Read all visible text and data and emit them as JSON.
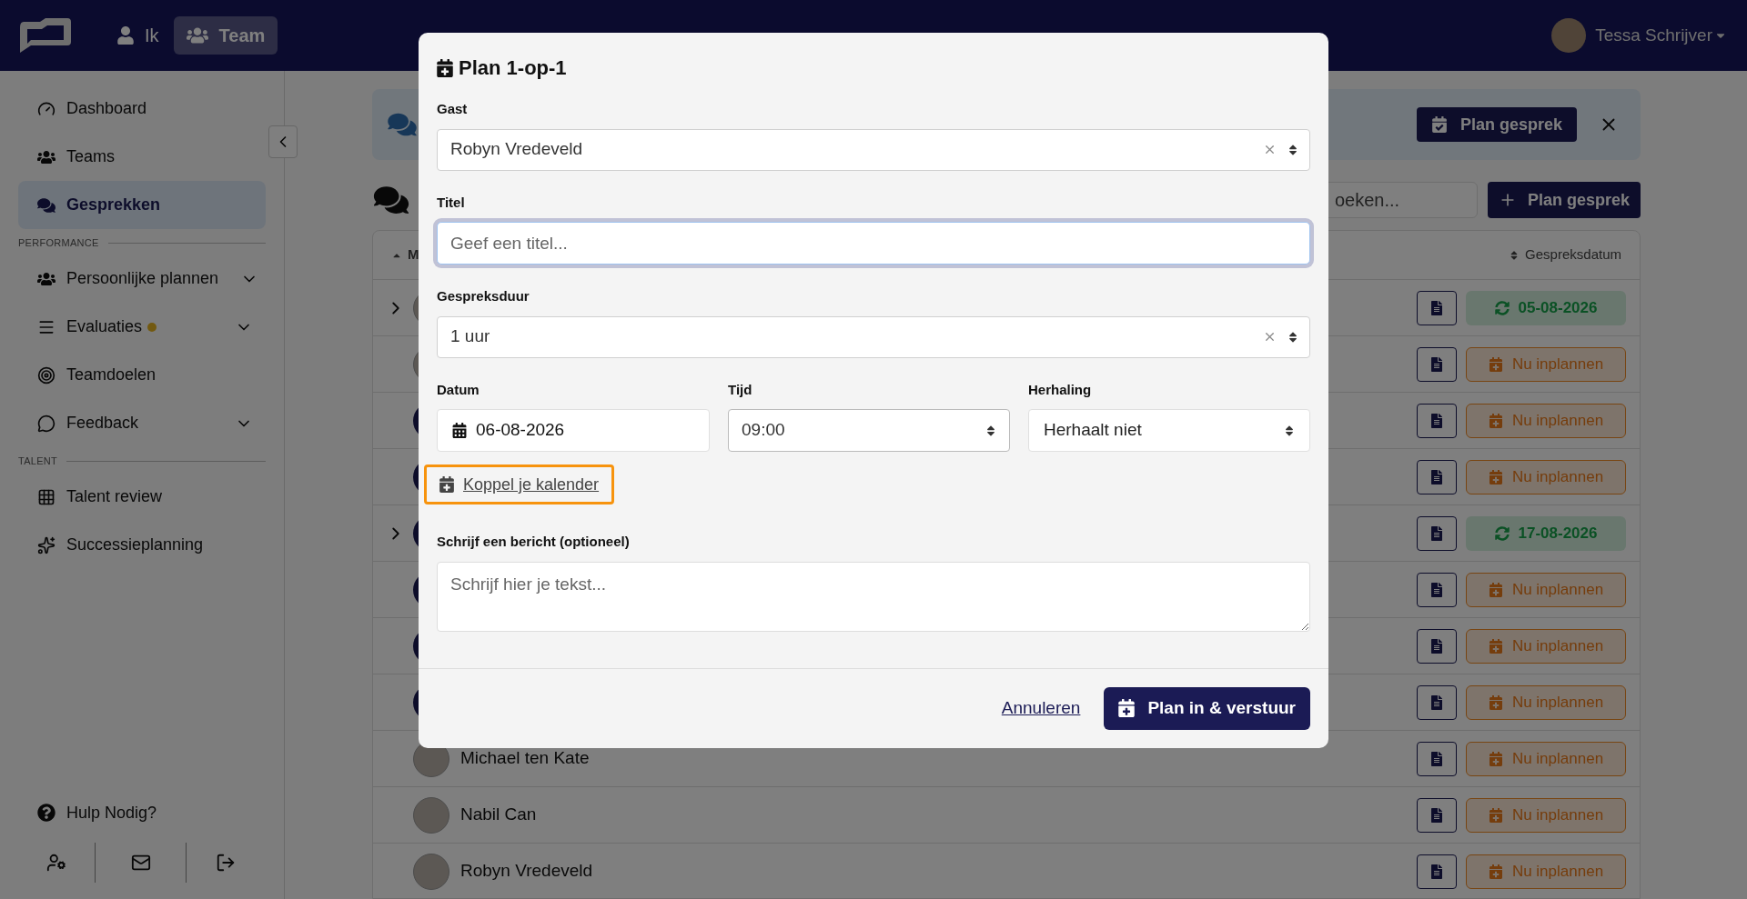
{
  "nav": {
    "tabs": [
      {
        "label": "Ik",
        "selected": false
      },
      {
        "label": "Team",
        "selected": true
      }
    ],
    "user": {
      "name": "Tessa Schrijver"
    }
  },
  "sidebar": {
    "sections": [
      {
        "items": [
          {
            "label": "Dashboard",
            "selected": false,
            "expandable": false,
            "notification": false
          },
          {
            "label": "Teams",
            "selected": false,
            "expandable": false,
            "notification": false
          },
          {
            "label": "Gesprekken",
            "selected": true,
            "expandable": false,
            "notification": false
          }
        ]
      },
      {
        "heading": "PERFORMANCE",
        "items": [
          {
            "label": "Persoonlijke plannen",
            "selected": false,
            "expandable": true,
            "notification": false
          },
          {
            "label": "Evaluaties",
            "selected": false,
            "expandable": true,
            "notification": true
          },
          {
            "label": "Teamdoelen",
            "selected": false,
            "expandable": false,
            "notification": false
          },
          {
            "label": "Feedback",
            "selected": false,
            "expandable": true,
            "notification": false
          }
        ]
      },
      {
        "heading": "TALENT",
        "items": [
          {
            "label": "Talent review",
            "selected": false,
            "expandable": false,
            "notification": false
          },
          {
            "label": "Successieplanning",
            "selected": false,
            "expandable": false,
            "notification": false
          }
        ]
      }
    ],
    "help": "Hulp Nodig?"
  },
  "banner": {
    "button": "Plan gesprek"
  },
  "toolbar": {
    "search_placeholder": "oeken...",
    "button": "Plan gesprek"
  },
  "table": {
    "columns": [
      {
        "label": "M",
        "sorted": true
      },
      {
        "label": "Gespreksdatum",
        "sorted": false
      }
    ],
    "rows": [
      {
        "avatar": {
          "kind": "photo"
        },
        "expandable": true,
        "status": {
          "kind": "scheduled",
          "label": "05-08-2026"
        }
      },
      {
        "avatar": {
          "kind": "photo"
        },
        "expandable": false,
        "status": {
          "kind": "todo",
          "label": "Nu inplannen"
        }
      },
      {
        "avatar": {
          "kind": "initials"
        },
        "expandable": false,
        "status": {
          "kind": "todo",
          "label": "Nu inplannen"
        }
      },
      {
        "avatar": {
          "kind": "initials"
        },
        "expandable": false,
        "status": {
          "kind": "todo",
          "label": "Nu inplannen"
        }
      },
      {
        "avatar": {
          "kind": "initials"
        },
        "expandable": true,
        "status": {
          "kind": "scheduled",
          "label": "17-08-2026"
        }
      },
      {
        "avatar": {
          "kind": "initials"
        },
        "expandable": false,
        "status": {
          "kind": "todo",
          "label": "Nu inplannen"
        }
      },
      {
        "avatar": {
          "kind": "initials"
        },
        "expandable": false,
        "status": {
          "kind": "todo",
          "label": "Nu inplannen"
        }
      },
      {
        "avatar": {
          "kind": "initials"
        },
        "expandable": false,
        "status": {
          "kind": "todo",
          "label": "Nu inplannen"
        }
      },
      {
        "avatar": {
          "kind": "photo"
        },
        "name": "Michael ten Kate",
        "expandable": false,
        "status": {
          "kind": "todo",
          "label": "Nu inplannen"
        }
      },
      {
        "avatar": {
          "kind": "photo"
        },
        "name": "Nabil Can",
        "expandable": false,
        "status": {
          "kind": "todo",
          "label": "Nu inplannen"
        }
      },
      {
        "avatar": {
          "kind": "photo"
        },
        "name": "Robyn Vredeveld",
        "expandable": false,
        "status": {
          "kind": "todo",
          "label": "Nu inplannen"
        }
      }
    ]
  },
  "modal": {
    "title": "Plan 1-op-1",
    "guest": {
      "label": "Gast",
      "value": "Robyn Vredeveld",
      "clearable": true
    },
    "title_field": {
      "label": "Titel",
      "placeholder": "Geef een titel...",
      "focused": true
    },
    "duration": {
      "label": "Gespreksduur",
      "value": "1 uur",
      "clearable": true
    },
    "date": {
      "label": "Datum",
      "value": "06-08-2026"
    },
    "time": {
      "label": "Tijd",
      "value": "09:00"
    },
    "repeat": {
      "label": "Herhaling",
      "value": "Herhaalt niet"
    },
    "calendar_link": {
      "label": "Koppel je kalender",
      "focused": true
    },
    "message": {
      "label": "Schrijf een bericht (optioneel)",
      "placeholder": "Schrijf hier je tekst..."
    },
    "cancel": "Annuleren",
    "submit": "Plan in & verstuur"
  }
}
